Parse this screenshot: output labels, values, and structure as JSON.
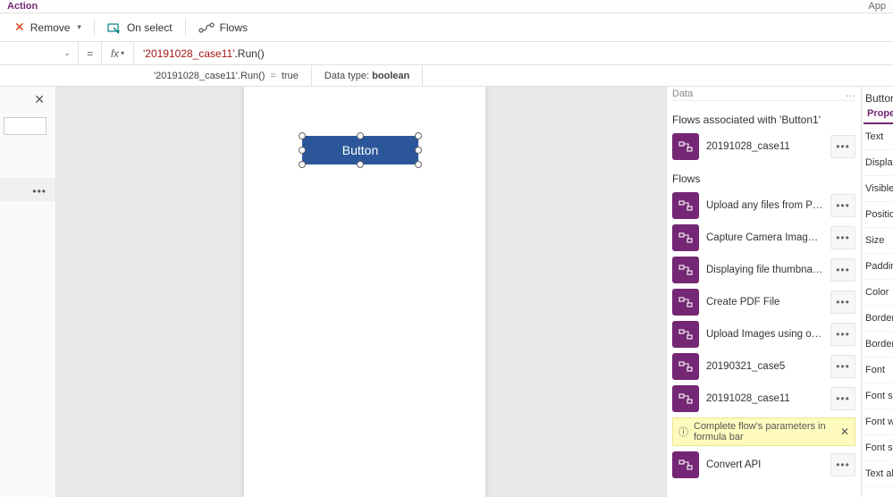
{
  "header": {
    "active_tab": "Action",
    "app_label": "App"
  },
  "ribbon": {
    "remove_label": "Remove",
    "onselect_label": "On select",
    "flows_label": "Flows"
  },
  "formula": {
    "fx_label": "fx",
    "text_str": "'20191028_case11'",
    "text_dot": ".",
    "text_meth": "Run()",
    "result_left": "'20191028_case11'.Run()",
    "result_eq": "=",
    "result_val": "true",
    "datatype_prefix": "Data type: ",
    "datatype_val": "boolean"
  },
  "canvas": {
    "button_text": "Button"
  },
  "data_panel": {
    "header": "Data",
    "assoc_title": "Flows associated with 'Button1'",
    "assoc_items": [
      {
        "label": "20191028_case11"
      }
    ],
    "flows_title": "Flows",
    "flows_items": [
      {
        "label": "Upload any files from Po..."
      },
      {
        "label": "Capture Camera Image t..."
      },
      {
        "label": "Displaying file thumbnail..."
      },
      {
        "label": "Create PDF File"
      },
      {
        "label": "Upload Images using ow..."
      },
      {
        "label": "20190321_case5"
      },
      {
        "label": "20191028_case11"
      }
    ],
    "warning_text": "Complete flow's parameters in formula bar",
    "flows_items2": [
      {
        "label": "Convert API"
      }
    ]
  },
  "props": {
    "title": "Button",
    "tab": "Proper",
    "rows": [
      "Text",
      "Display",
      "Visible",
      "Positio",
      "Size",
      "Paddin",
      "Color",
      "Border",
      "Border",
      "Font",
      "Font si",
      "Font w",
      "Font st",
      "Text al"
    ]
  }
}
